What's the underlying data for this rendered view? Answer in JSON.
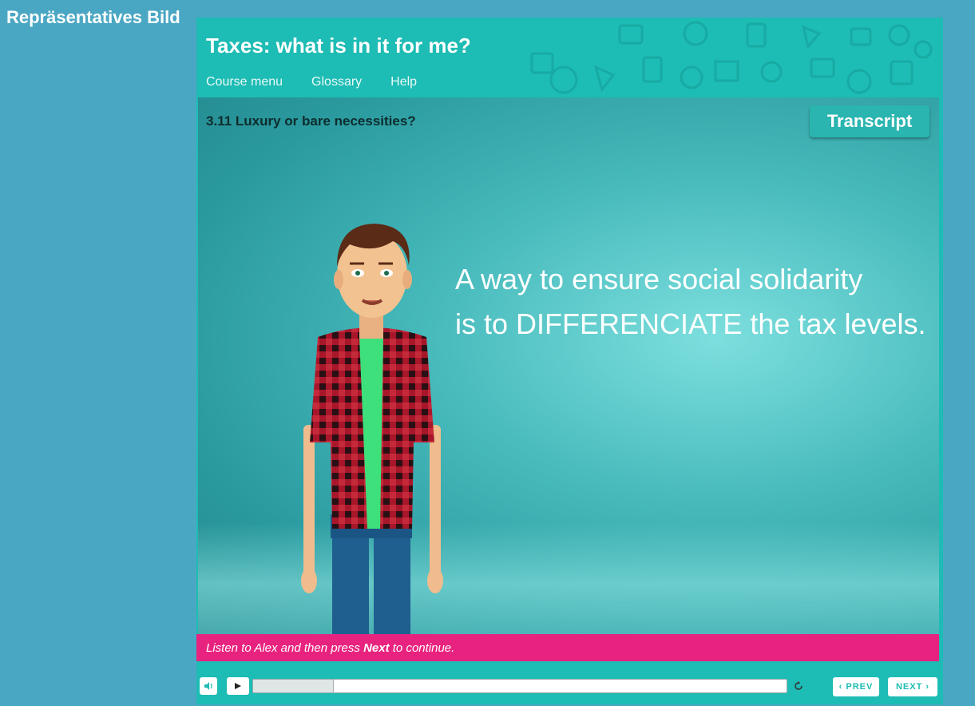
{
  "outer_label": "Repräsentatives Bild",
  "course": {
    "title": "Taxes: what is in it for me?",
    "nav": [
      "Course menu",
      "Glossary",
      "Help"
    ]
  },
  "slide": {
    "title": "3.11 Luxury or bare necessities?",
    "transcript_label": "Transcript",
    "text_line1": "A way to ensure social solidarity",
    "text_line2": "is to DIFFERENCIATE the tax levels."
  },
  "instruction": {
    "prefix": "Listen to Alex and then press ",
    "strong": "Next",
    "suffix": " to continue."
  },
  "controls": {
    "progress": 0.15,
    "prev_label": "‹ PREV",
    "next_label": "NEXT ›"
  },
  "colors": {
    "page_bg": "#4aa7c3",
    "brand_teal": "#1dbcb4",
    "instruction_pink": "#e8237f"
  },
  "icons": {
    "volume": "volume-icon",
    "play": "play-icon",
    "replay": "replay-icon"
  }
}
